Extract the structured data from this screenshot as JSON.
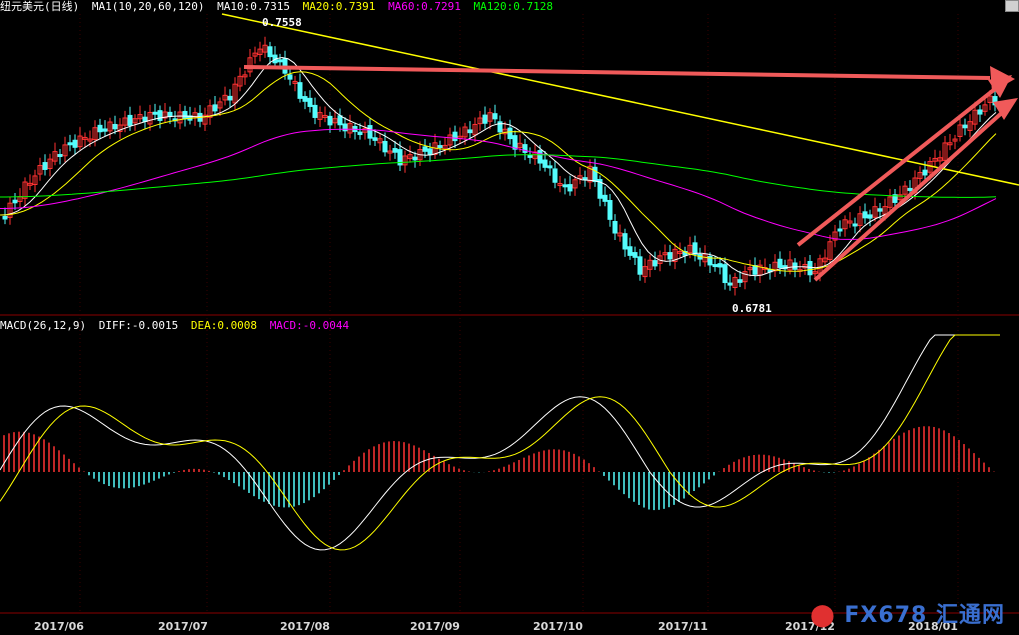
{
  "header": {
    "instrument": "纽元美元(日线)",
    "ma_label": "MA1(10,20,60,120)",
    "ma10": "MA10:0.7315",
    "ma20": "MA20:0.7391",
    "ma60": "MA60:0.7291",
    "ma120": "MA120:0.7128"
  },
  "macd_header": {
    "label": "MACD(26,12,9)",
    "diff": "DIFF:-0.0015",
    "dea": "DEA:0.0008",
    "macd": "MACD:-0.0044"
  },
  "price_annotations": {
    "high": "0.7558",
    "low": "0.6781"
  },
  "x_axis_labels": [
    "2017/06",
    "2017/07",
    "2017/08",
    "2017/09",
    "2017/10",
    "2017/11",
    "2017/12",
    "2018/01"
  ],
  "logo": {
    "text": "FX678",
    "cn": "汇通网"
  },
  "colors": {
    "up": "#ff3232",
    "down": "#54fcfc",
    "ma10": "#ffffff",
    "ma20": "#ffff00",
    "ma60": "#ff00ff",
    "ma120": "#00ff00",
    "trend": "#ffff00",
    "arrow": "#f05a5a"
  },
  "chart_data": [
    {
      "type": "candlestick",
      "title": "",
      "y_range": [
        0.6781,
        0.7558
      ],
      "series": [
        {
          "name": "MA10",
          "value": 0.7315
        },
        {
          "name": "MA20",
          "value": 0.7391
        },
        {
          "name": "MA60",
          "value": 0.7291
        },
        {
          "name": "MA120",
          "value": 0.7128
        }
      ],
      "x_ticks": [
        "2017/06",
        "2017/07",
        "2017/08",
        "2017/09",
        "2017/10",
        "2017/11",
        "2017/12",
        "2018/01"
      ],
      "annotations": [
        "0.7558",
        "0.6781"
      ]
    },
    {
      "type": "bar",
      "title": "MACD(26,12,9)",
      "series": [
        {
          "name": "DIFF",
          "value": -0.0015
        },
        {
          "name": "DEA",
          "value": 0.0008
        },
        {
          "name": "MACD",
          "value": -0.0044
        }
      ]
    }
  ]
}
